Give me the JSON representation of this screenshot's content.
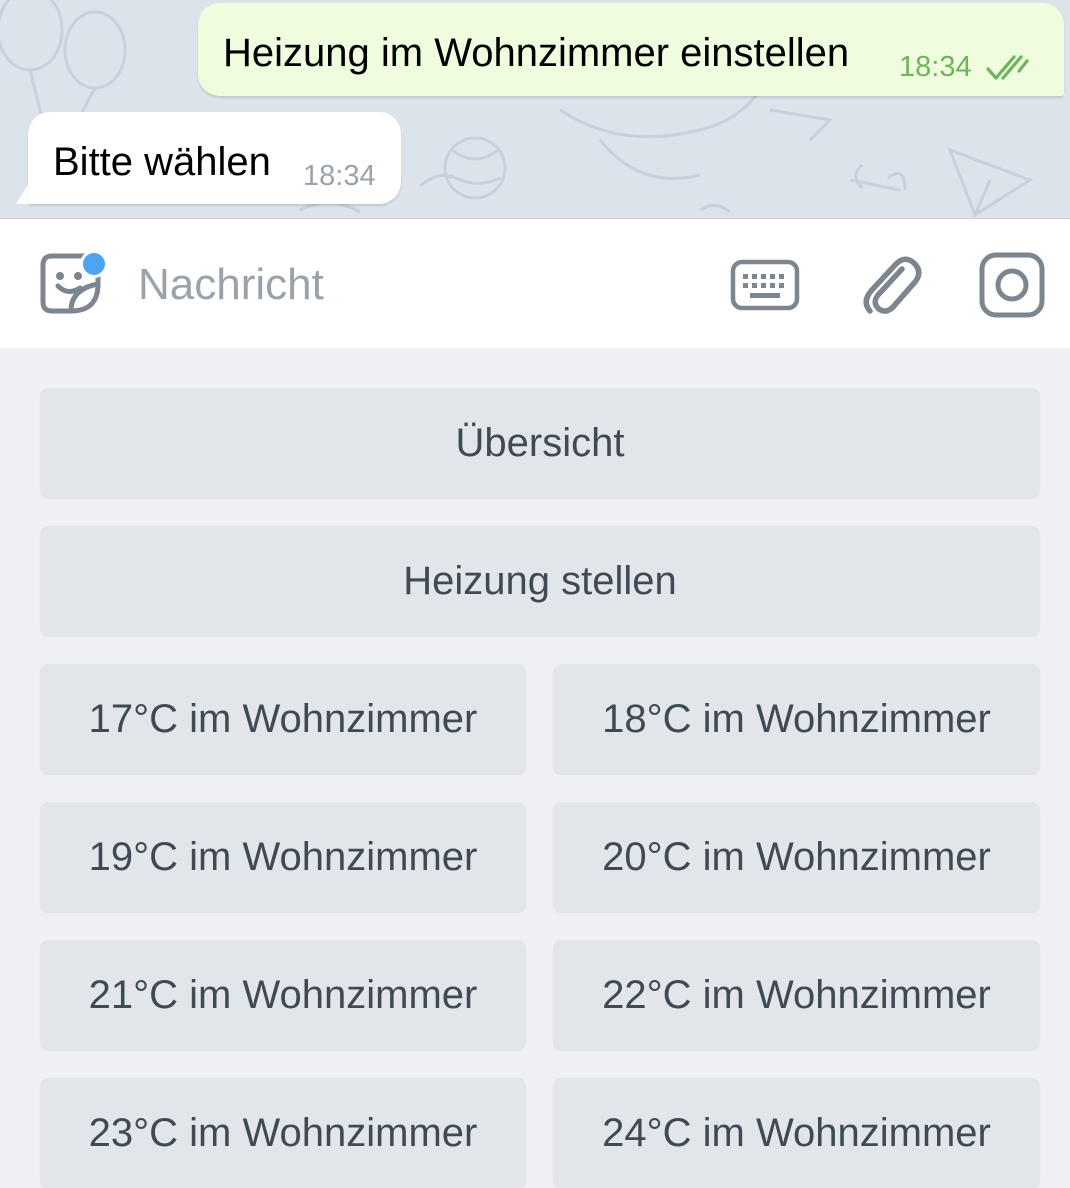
{
  "chat": {
    "outgoing": {
      "text": "Heizung im Wohnzimmer einstellen",
      "time": "18:34",
      "status": "read-double-check"
    },
    "incoming": {
      "text": "Bitte wählen",
      "time": "18:34"
    }
  },
  "input": {
    "placeholder": "Nachricht",
    "icons": [
      "sticker-icon",
      "keyboard-icon",
      "attach-icon",
      "camera-icon"
    ]
  },
  "keyboard": {
    "rows": [
      [
        "Übersicht"
      ],
      [
        "Heizung stellen"
      ],
      [
        "17°C im Wohnzimmer",
        "18°C im Wohnzimmer"
      ],
      [
        "19°C im Wohnzimmer",
        "20°C im Wohnzimmer"
      ],
      [
        "21°C im Wohnzimmer",
        "22°C im Wohnzimmer"
      ],
      [
        "23°C im Wohnzimmer",
        "24°C im Wohnzimmer"
      ]
    ]
  },
  "colors": {
    "outgoing_bubble": "#effdde",
    "incoming_bubble": "#ffffff",
    "read_ticks": "#6fb35a",
    "notify_dot": "#4ea4f0",
    "button_bg": "#e2e6ea",
    "button_text": "#3f4a55"
  }
}
